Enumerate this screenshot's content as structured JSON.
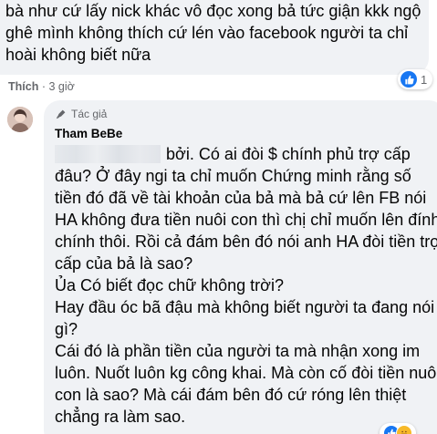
{
  "comment1": {
    "text": "bà như cứ lấy nick khác vô đọc xong bả tức giận kkk ngộ ghê mình không thích cứ lén vào facebook người ta chỉ hoài không biết nữa",
    "reaction_count": "1",
    "like_label": "Thích",
    "time": "3 giờ"
  },
  "comment2": {
    "badge": "Tác giả",
    "author": "Tham BeBe",
    "lines": [
      "bởi. Có ai đòi $ chính phủ trợ cấp đâu? Ở đây ngi ta chỉ muốn Chứng minh rằng số tiền đó đã về tài khoản của bả mà bả cứ lên FB nói HA không đưa tiền nuôi con thì chị chỉ muốn lên đính chính thôi. Rồi cả đám bên đó nói anh HA đòi tiền trợ cấp của bả là sao?",
      "Ủa Có biết đọc chữ không trời?",
      "Hay đầu óc bã đậu mà không biết người ta đang nói gì?",
      "Cái đó là phần tiền của người ta mà nhận xong im luôn. Nuốt luôn kg công khai. Mà còn cố đòi tiền nuôi con là sao? Mà cái đám bên đó cứ róng lên thiệt chẳng ra làm sao."
    ]
  },
  "colors": {
    "bubble": "#f0f2f5",
    "like_blue": "#1877f2",
    "meta_gray": "#65676b"
  },
  "icons": [
    "like-reaction-icon",
    "author-badge-icon",
    "haha-reaction-icon"
  ]
}
